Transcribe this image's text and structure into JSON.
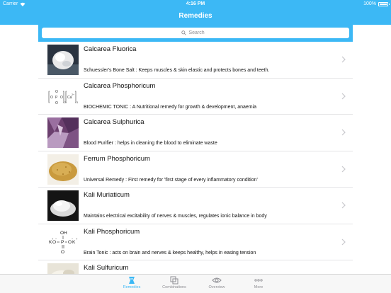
{
  "status": {
    "carrier": "Carrier",
    "time": "4:16 PM",
    "battery": "100%"
  },
  "nav": {
    "title": "Remedies"
  },
  "search": {
    "placeholder": "Search"
  },
  "remedies": [
    {
      "name": "Calcarea Fluorica",
      "description": "Schuessler's Bone Salt : Keeps muscles & skin elastic and protects bones and teeth."
    },
    {
      "name": "Calcarea Phosphoricum",
      "description": "BIOCHEMIC TONIC : A Nutritional remedy for growth & development, anaemia"
    },
    {
      "name": "Calcarea Sulphurica",
      "description": "Blood Purifier : helps in cleaning the blood to eliminate waste"
    },
    {
      "name": "Ferrum Phosphoricum",
      "description": "Universal Remedy : First remedy for 'first stage of every inflammatory condition'"
    },
    {
      "name": "Kali Muriaticum",
      "description": "Maintains electrical excitability of nerves & muscles, regulates ionic balance in body"
    },
    {
      "name": "Kali Phosphoricum",
      "description": "Brain Tonic : acts on brain and nerves & keeps healthy, helps in easing tension"
    },
    {
      "name": "Kali Sulfuricum",
      "description": ""
    }
  ],
  "formulas": {
    "calc_phos": {
      "o": "O",
      "p": "P",
      "ca": "Ca",
      "sub3": "3",
      "sub2": "2",
      "charge": "2+"
    },
    "kali_phos": {
      "oh": "OH",
      "k1": "K",
      "o1": "O",
      "p": "P",
      "o2": "O",
      "k2": "K",
      "plus": "+",
      "minus": "−",
      "o3": "O"
    }
  },
  "tabs": [
    {
      "label": "Remedies",
      "icon": "remedies-icon",
      "active": true
    },
    {
      "label": "Combinations",
      "icon": "combinations-icon",
      "active": false
    },
    {
      "label": "Overview",
      "icon": "eye-icon",
      "active": false
    },
    {
      "label": "More",
      "icon": "more-icon",
      "active": false
    }
  ],
  "colors": {
    "accent": "#3cb8f5",
    "separator": "#e4e4e6",
    "tab_inactive": "#8e8e93"
  }
}
